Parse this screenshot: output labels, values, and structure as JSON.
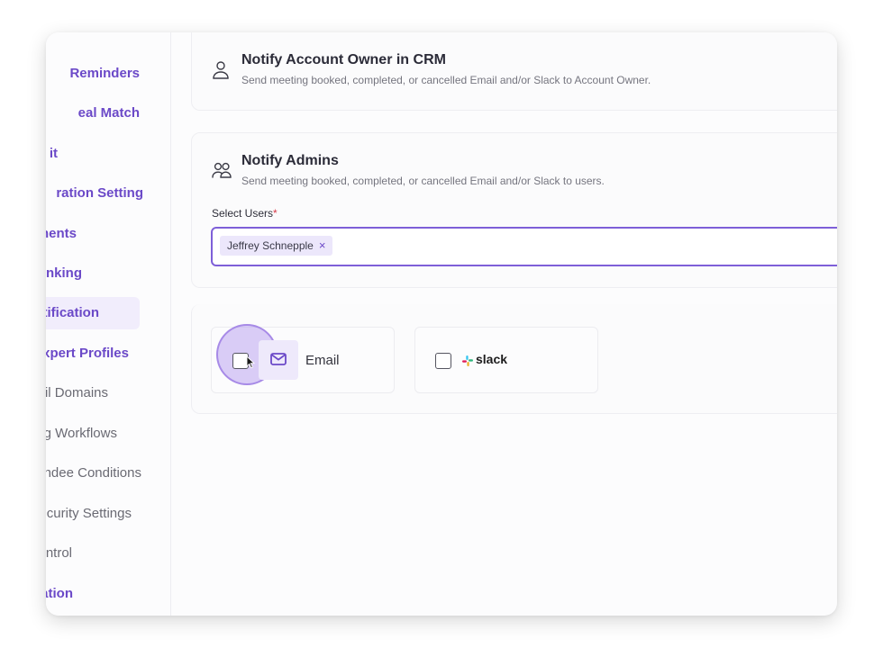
{
  "sidebar": {
    "items": [
      {
        "label": "Reminders",
        "accent": true,
        "active": false
      },
      {
        "label": "eal Match",
        "accent": true,
        "active": false
      },
      {
        "label": "it",
        "accent": true,
        "active": false
      },
      {
        "label": "ration Setting",
        "accent": true,
        "active": false
      },
      {
        "label": "nents",
        "accent": true,
        "active": false
      },
      {
        "label": "nking",
        "accent": true,
        "active": false
      },
      {
        "label": "tification",
        "accent": true,
        "active": true
      },
      {
        "label": "xpert Profiles",
        "accent": true,
        "active": false
      },
      {
        "label": "il Domains",
        "accent": false,
        "active": false
      },
      {
        "label": "g Workflows",
        "accent": false,
        "active": false
      },
      {
        "label": "ndee Conditions",
        "accent": false,
        "active": false
      },
      {
        "label": "curity Settings",
        "accent": false,
        "active": false
      },
      {
        "label": "ntrol",
        "accent": false,
        "active": false
      },
      {
        "label": "ation",
        "accent": true,
        "active": false
      }
    ]
  },
  "notify_owner": {
    "title": "Notify Account Owner in CRM",
    "description": "Send meeting booked, completed, or cancelled Email and/or Slack to Account Owner.",
    "icon": "user-icon"
  },
  "notify_admins": {
    "title": "Notify Admins",
    "description": "Send meeting booked, completed, or cancelled Email and/or Slack to users.",
    "icon": "users-icon",
    "select_label": "Select Users",
    "required_mark": "*",
    "selected_users": [
      "Jeffrey Schnepple"
    ],
    "chip_remove": "×"
  },
  "channels": {
    "email": {
      "label": "Email",
      "checked": false,
      "icon": "envelope-icon"
    },
    "slack": {
      "label": "slack",
      "checked": false,
      "icon": "slack-logo-icon"
    }
  },
  "colors": {
    "accent": "#6b49c8",
    "focus_border": "#7e5fd8",
    "chip_bg": "#ece7fb",
    "active_nav_bg": "#f1edfc"
  }
}
